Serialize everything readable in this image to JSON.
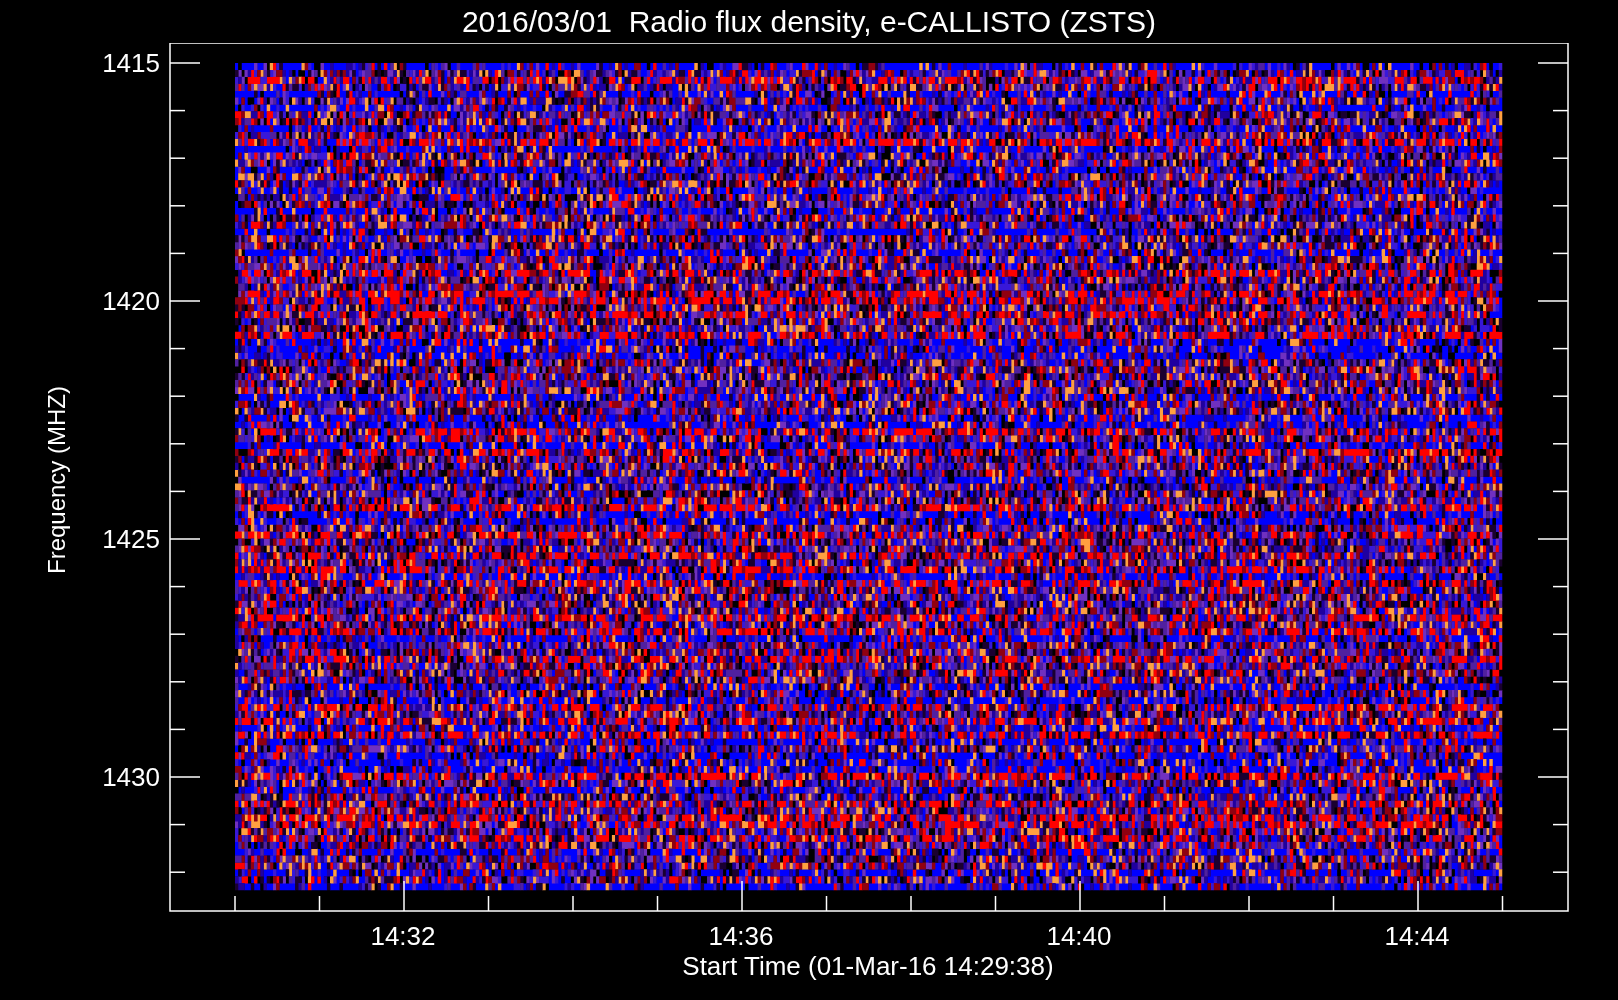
{
  "title": "2016/03/01  Radio flux density, e-CALLISTO (ZSTS)",
  "y_axis": {
    "label": "Frequency (MHZ)",
    "ticks": [
      "1415",
      "1420",
      "1425",
      "1430"
    ]
  },
  "x_axis": {
    "label": "Start Time (01-Mar-16 14:29:38)",
    "ticks": [
      "14:32",
      "14:36",
      "14:40",
      "14:44"
    ]
  }
}
